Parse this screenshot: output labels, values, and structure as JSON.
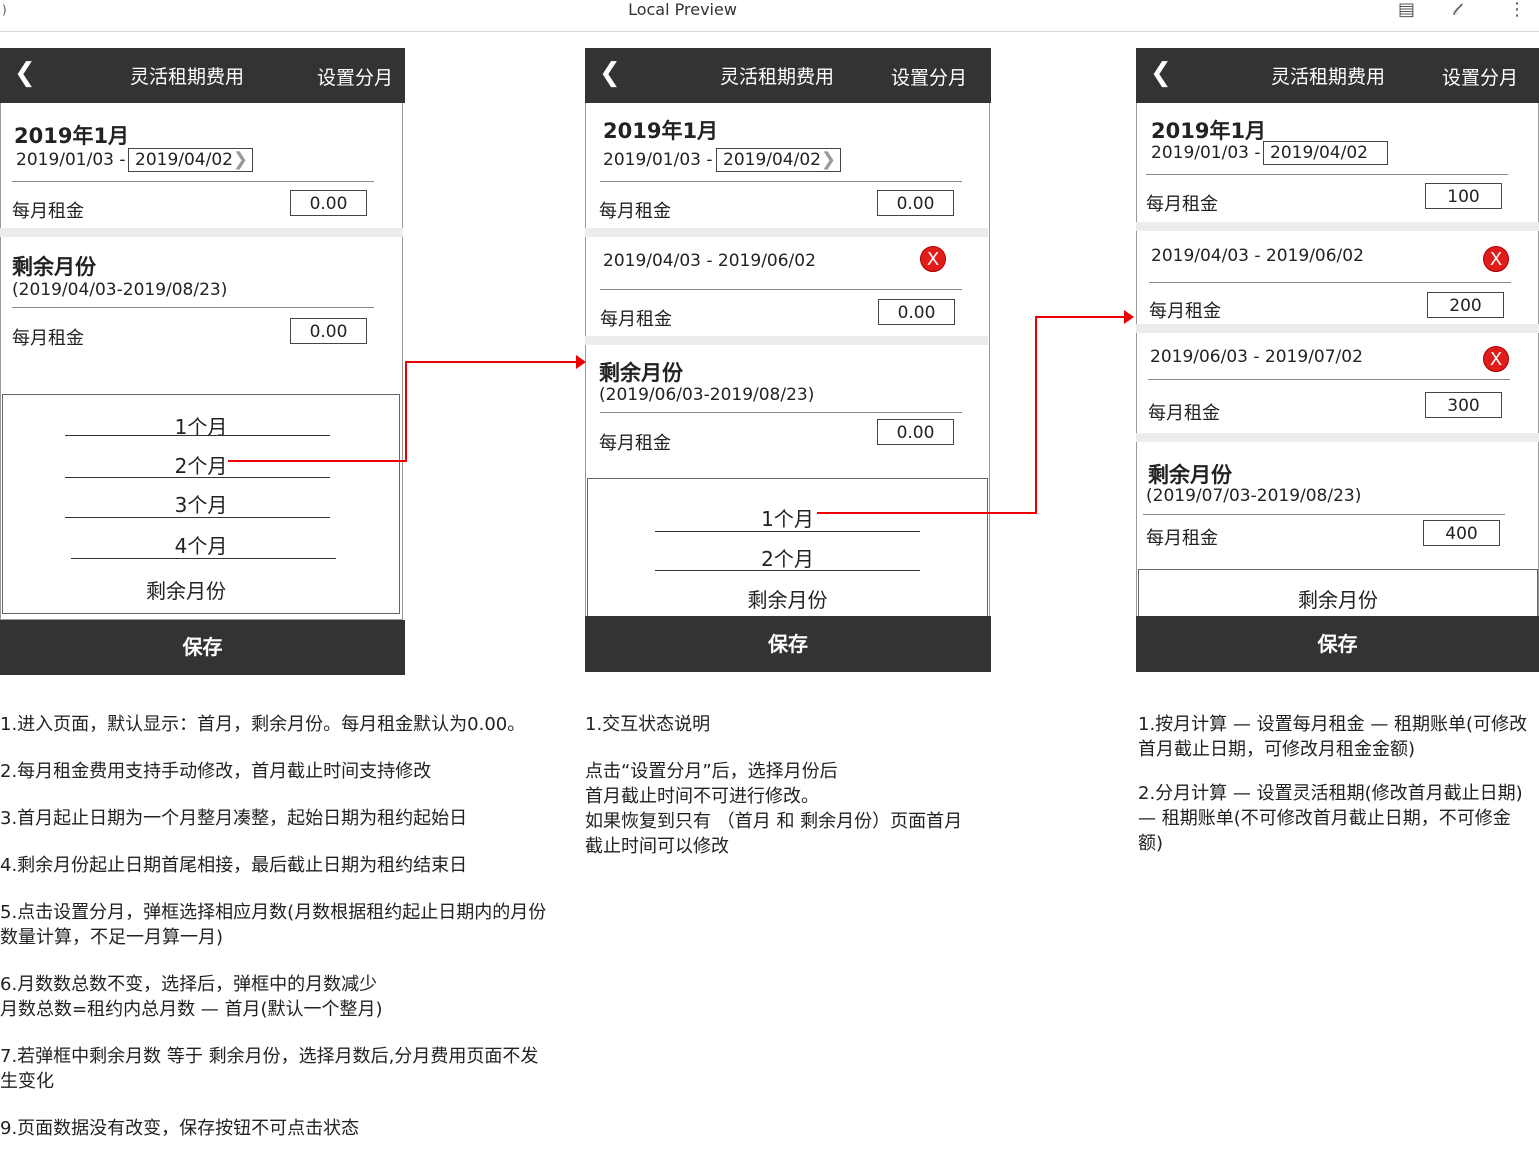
{
  "window": {
    "title": "Local Preview",
    "menu_glyph": ")"
  },
  "screens": [
    {
      "header": {
        "title": "灵活租期费用",
        "action": "设置分月"
      },
      "first_month": {
        "title": "2019年1月",
        "start": "2019/01/03 -",
        "end": "2019/04/02",
        "rent_label": "每月租金",
        "rent_value": "0.00"
      },
      "remaining": {
        "title": "剩余月份",
        "range": "(2019/04/03-2019/08/23)",
        "rent_label": "每月租金",
        "rent_value": "0.00"
      },
      "picker": [
        "1个月",
        "2个月",
        "3个月",
        "4个月",
        "剩余月份"
      ],
      "save": "保存"
    },
    {
      "header": {
        "title": "灵活租期费用",
        "action": "设置分月"
      },
      "first_month": {
        "title": "2019年1月",
        "start": "2019/01/03 -",
        "end": "2019/04/02",
        "rent_label": "每月租金",
        "rent_value": "0.00"
      },
      "split": {
        "range": "2019/04/03 - 2019/06/02",
        "rent_label": "每月租金",
        "rent_value": "0.00"
      },
      "remaining": {
        "title": "剩余月份",
        "range": "(2019/06/03-2019/08/23)",
        "rent_label": "每月租金",
        "rent_value": "0.00"
      },
      "picker": [
        "1个月",
        "2个月",
        "剩余月份"
      ],
      "save": "保存"
    },
    {
      "header": {
        "title": "灵活租期费用",
        "action": "设置分月"
      },
      "first_month": {
        "title": "2019年1月",
        "start": "2019/01/03 -",
        "end": "2019/04/02",
        "rent_label": "每月租金",
        "rent_value": "100"
      },
      "split1": {
        "range": "2019/04/03 - 2019/06/02",
        "rent_label": "每月租金",
        "rent_value": "200"
      },
      "split2": {
        "range": "2019/06/03 - 2019/07/02",
        "rent_label": "每月租金",
        "rent_value": "300"
      },
      "remaining": {
        "title": "剩余月份",
        "range": "(2019/07/03-2019/08/23)",
        "rent_label": "每月租金",
        "rent_value": "400"
      },
      "picker": [
        "剩余月份"
      ],
      "save": "保存"
    }
  ],
  "notes1": [
    "1.进入页面，默认显示：首月，剩余月份。每月租金默认为0.00。",
    "2.每月租金费用支持手动修改，首月截止时间支持修改",
    "3.首月起止日期为一个月整月凑整，起始日期为租约起始日",
    "4.剩余月份起止日期首尾相接，最后截止日期为租约结束日",
    "5.点击设置分月，弹框选择相应月数(月数根据租约起止日期内的月份",
    "数量计算，不足一月算一月)",
    "6.月数数总数不变，选择后，弹框中的月数减少",
    "月数总数=租约内总月数 — 首月(默认一个整月)",
    "7.若弹框中剩余月数 等于 剩余月份，选择月数后,分月费用页面不发",
    "生变化",
    "9.页面数据没有改变，保存按钮不可点击状态"
  ],
  "notes2": [
    "1.交互状态说明",
    "点击“设置分月”后，选择月份后",
    "首月截止时间不可进行修改。",
    "如果恢复到只有 （首月 和 剩余月份）页面首月",
    "截止时间可以修改"
  ],
  "notes3": [
    "1.按月计算 — 设置每月租金 — 租期账单(可修改",
    "首月截止日期，可修改月租金金额)",
    "2.分月计算 — 设置灵活租期(修改首月截止日期)",
    "— 租期账单(不可修改首月截止日期，不可修金",
    "额)"
  ],
  "colors": {
    "header_bg": "#333333",
    "delete_red": "#e21b1b",
    "arrow_red": "#ee0000"
  }
}
